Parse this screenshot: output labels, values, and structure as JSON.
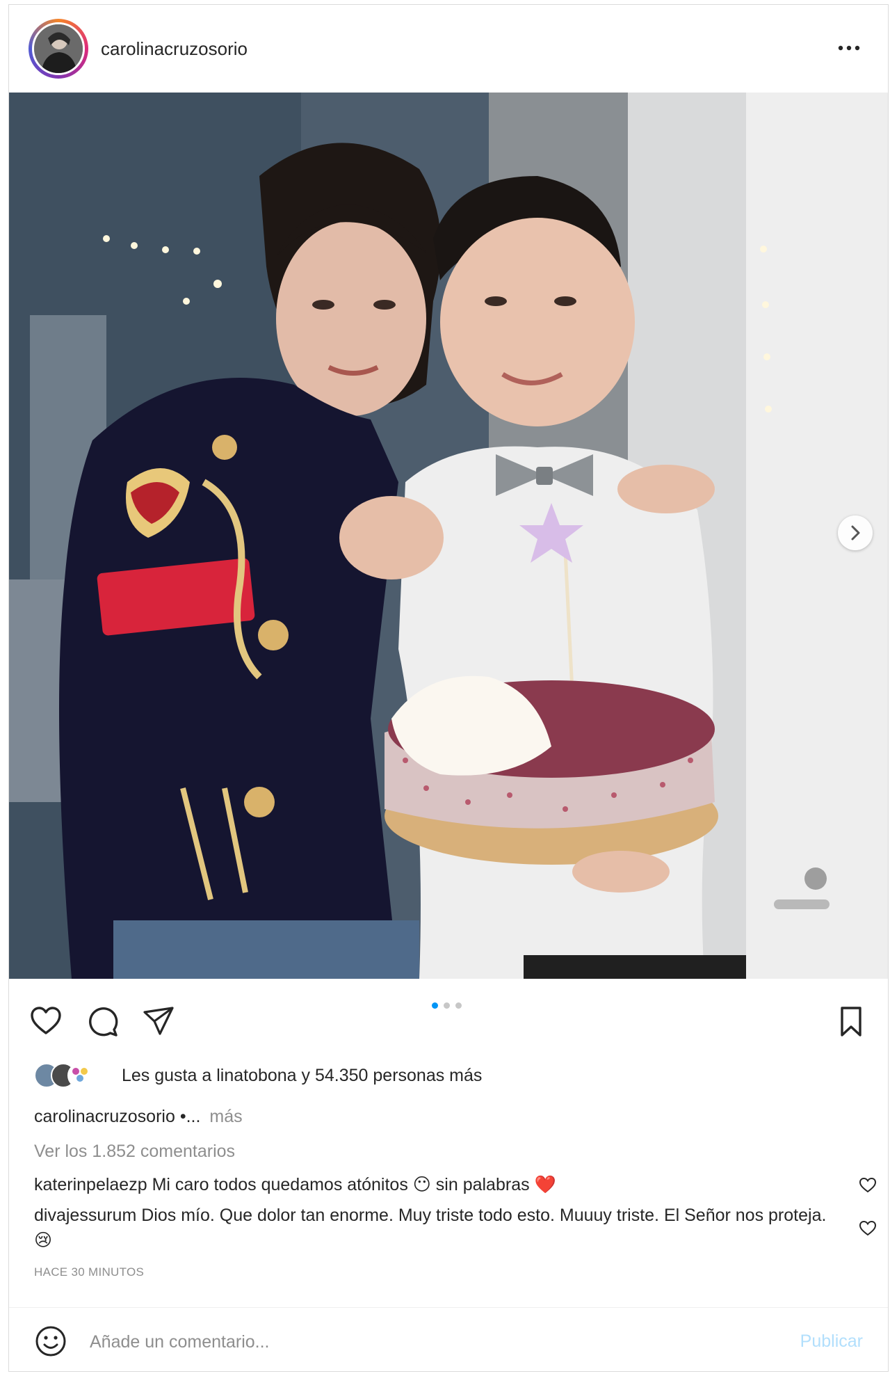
{
  "post": {
    "username": "carolinacruzosorio",
    "more_icon": "more-horizontal-icon",
    "photo_alt": "",
    "carousel": {
      "count": 3,
      "active_index": 0
    }
  },
  "actions": {
    "like_icon": "heart-icon",
    "comment_icon": "comment-bubble-icon",
    "share_icon": "paper-plane-icon",
    "save_icon": "bookmark-icon"
  },
  "likes": {
    "text": "Les gusta a linatobona y 54.350 personas más"
  },
  "caption": {
    "user": "carolinacruzosorio",
    "text": "•...",
    "more": "más"
  },
  "view_comments": "Ver los 1.852 comentarios",
  "comments": [
    {
      "user": "katerinpelaezp",
      "text": "Mi caro todos quedamos atónitos 😶 sin palabras ❤️"
    },
    {
      "user": "divajessurum",
      "text": "Dios mío. Que dolor tan enorme. Muy triste todo esto. Muuuy triste. El Señor nos proteja. 😢"
    }
  ],
  "timestamp": "HACE 30 MINUTOS",
  "add_comment": {
    "placeholder": "Añade un comentario...",
    "publish": "Publicar"
  },
  "colors": {
    "accent": "#0095f6",
    "publish_disabled": "#b2dffc",
    "muted": "#8e8e8e",
    "text": "#262626"
  }
}
